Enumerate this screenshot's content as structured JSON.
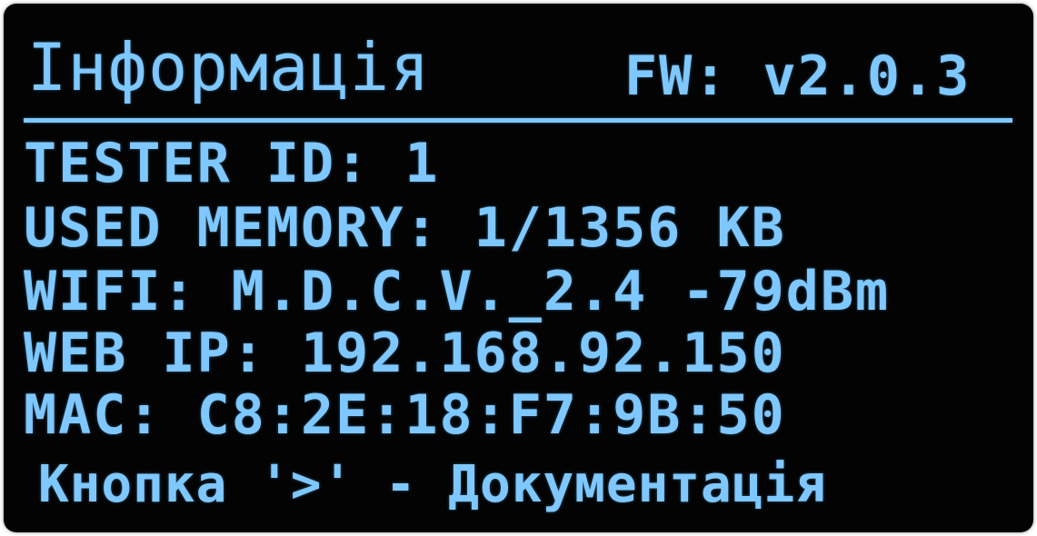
{
  "display": {
    "colors": {
      "background": "#030303",
      "foreground": "#7ec8ff"
    }
  },
  "header": {
    "title": "Інформація",
    "fw_label": "FW:",
    "fw_version": "v2.0.3"
  },
  "rows": [
    {
      "label": "TESTER ID:",
      "value": "1"
    },
    {
      "label": "USED MEMORY:",
      "value": "1/1356 KB"
    },
    {
      "label": "WIFI:",
      "value": "M.D.C.V._2.4 -79dBm"
    },
    {
      "label": "WEB IP:",
      "value": "192.168.92.150"
    },
    {
      "label": "MAC:",
      "value": "C8:2E:18:F7:9B:50"
    }
  ],
  "footer": {
    "hint": "Кнопка '>' - Документація"
  }
}
